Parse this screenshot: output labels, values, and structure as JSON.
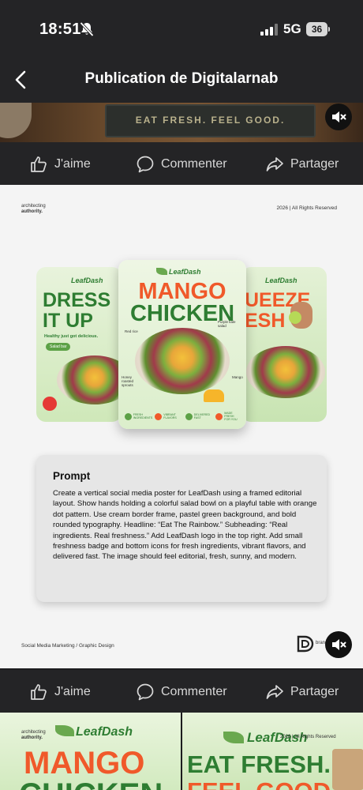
{
  "status_bar": {
    "time": "18:51",
    "network": "5G",
    "battery": "36"
  },
  "nav": {
    "title": "Publication de Digitalarnab"
  },
  "top_image": {
    "mat_text": "EAT FRESH. FEEL GOOD."
  },
  "actions": {
    "like": "J'aime",
    "comment": "Commenter",
    "share": "Partager"
  },
  "post": {
    "brand_line1": "architecting",
    "brand_line2": "authority.",
    "rights": "2026 | All Rights Reserved",
    "posters": {
      "logo": "LeafDash",
      "left_headline_1": "DRESS",
      "left_headline_2": "IT UP",
      "left_sub": "Healthy just got delicious.",
      "left_badge": "Salad bar",
      "center_headline_1": "MANGO",
      "center_headline_2": "CHICKEN",
      "center_callout_1": "Purple kale salad",
      "center_callout_2": "Red rice",
      "center_callout_3": "Honey roasted sprouts",
      "center_callout_4": "Mango",
      "center_icon_1": "FRESH INGREDIENTS",
      "center_icon_2": "VIBRANT FLAVORS",
      "center_icon_3": "DELIVERED FAST",
      "center_icon_4": "MADE FRESH FOR YOU",
      "right_headline_1": "UEEZE",
      "right_headline_2": "ESH"
    },
    "prompt_title": "Prompt",
    "prompt_text": "Create a vertical social media poster for LeafDash using a framed editorial layout. Show hands holding a colorful salad bowl on a playful table with orange dot pattern. Use cream border frame, pastel green background, and bold rounded typography. Headline: “Eat The Rainbow.” Subheading: “Real ingredients. Real freshness.” Add LeafDash logo in the top right. Add small freshness badge and bottom icons for fresh ingredients, vibrant flavors, and delivered fast. The image should feel editorial, fresh, sunny, and modern.",
    "footer": "Social Media Marketing / Graphic Design",
    "footer_brand": "brand agency"
  },
  "next_post": {
    "brand_line1": "architecting",
    "brand_line2": "authority.",
    "logo": "LeafDash",
    "left_headline_1": "MANGO",
    "left_headline_2": "CHICKEN",
    "right_headline_1": "EAT FRESH.",
    "right_headline_2": "FEEL GOOD",
    "rights": "2026 | All Rights Reserved"
  },
  "colors": {
    "accent_orange": "#f0592a",
    "leaf_green": "#2e7d32",
    "bar_bg": "#242426"
  }
}
